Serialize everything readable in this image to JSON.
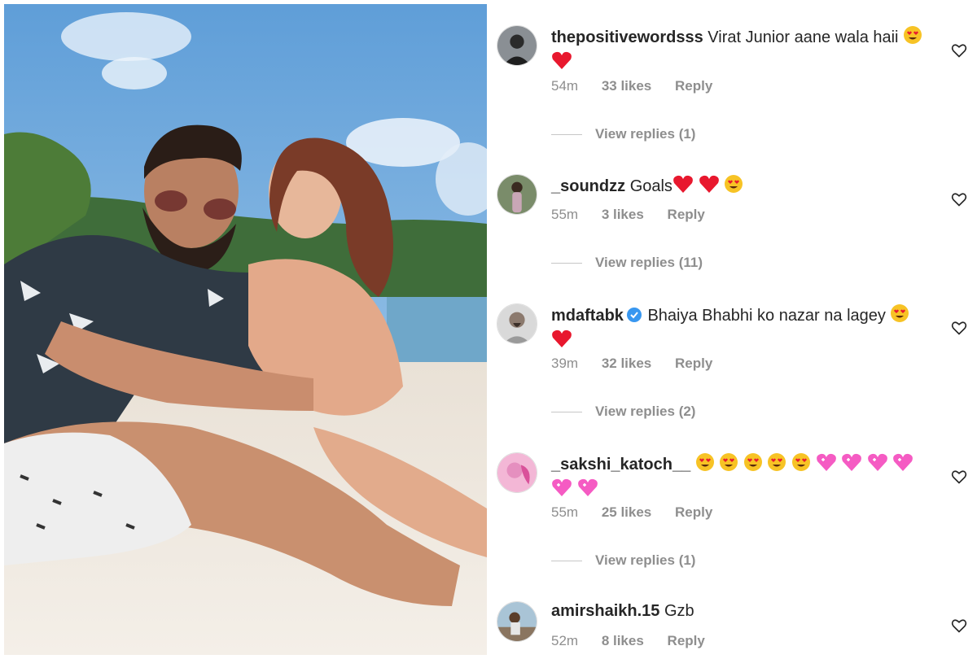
{
  "post": {
    "photo": "couple-on-beach-photo"
  },
  "comments": [
    {
      "username": "thepositivewordsss",
      "verified": false,
      "text": "Virat Junior aane wala haii",
      "emojis": [
        "heart-eyes",
        "red-heart"
      ],
      "time": "54m",
      "likes": "33 likes",
      "reply": "Reply",
      "view_replies": "View replies (1)"
    },
    {
      "username": "_soundzz",
      "verified": false,
      "text": "Goals",
      "emojis": [
        "red-heart",
        "red-heart",
        "heart-eyes"
      ],
      "time": "55m",
      "likes": "3 likes",
      "reply": "Reply",
      "view_replies": "View replies (11)"
    },
    {
      "username": "mdaftabk",
      "verified": true,
      "text": "Bhaiya Bhabhi ko nazar na lagey",
      "emojis": [
        "heart-eyes",
        "red-heart"
      ],
      "time": "39m",
      "likes": "32 likes",
      "reply": "Reply",
      "view_replies": "View replies (2)"
    },
    {
      "username": "_sakshi_katoch__",
      "verified": false,
      "text": "",
      "emojis": [
        "heart-eyes",
        "heart-eyes",
        "heart-eyes",
        "heart-eyes",
        "heart-eyes",
        "pink-heart",
        "pink-heart",
        "pink-heart",
        "pink-heart",
        "pink-heart",
        "pink-heart"
      ],
      "time": "55m",
      "likes": "25 likes",
      "reply": "Reply",
      "view_replies": "View replies (1)"
    },
    {
      "username": "amirshaikh.15",
      "verified": false,
      "text": "Gzb",
      "emojis": [],
      "time": "52m",
      "likes": "8 likes",
      "reply": "Reply",
      "view_replies": ""
    }
  ],
  "colors": {
    "text": "#262626",
    "muted": "#8e8e8e",
    "verified": "#3897f0",
    "heart": "#e8182e",
    "heart_eyes": "#f7c325",
    "pink_heart": "#f55bc3"
  }
}
